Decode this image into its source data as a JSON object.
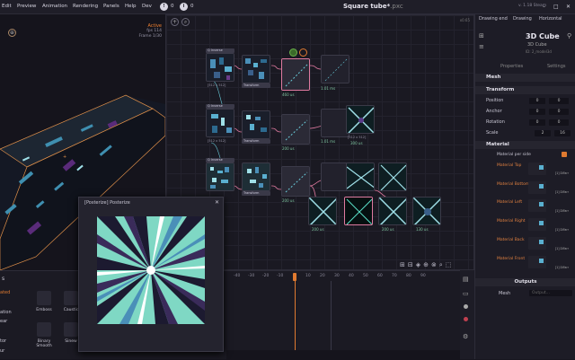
{
  "menubar": {
    "items": [
      "Edit",
      "Preview",
      "Animation",
      "Rendering",
      "Panels",
      "Help",
      "Dev"
    ],
    "counter1": "0",
    "counter2": "0",
    "title": "Square tube*",
    "title_ext": ".pxc",
    "version": "v. 1.18 Steam",
    "win_min": "–",
    "win_max": "□",
    "win_close": "✕"
  },
  "viewport": {
    "status": "Active",
    "fps": "fps 114",
    "frame": "Frame 1/30"
  },
  "graph": {
    "zoom": "x0.65",
    "nodes_top_label": "Q Inverse",
    "sizes": [
      "[512 x 512]",
      "[512 x 512]",
      "[512 x 512]"
    ],
    "times": [
      "460 us",
      "1.01 ms",
      "1.01 ms",
      "200 us",
      "200 us",
      "300 us",
      "200 us",
      "200 us",
      "130 us",
      "200 us"
    ],
    "transform": "Transform",
    "tile": "Tile",
    "blend": "Blend",
    "ftype": "32bit"
  },
  "inspector": {
    "tabs": [
      "Drawing end",
      "Drawing",
      "Horizontal"
    ],
    "node_title": "3D Cube",
    "node_sub": "3D Cube",
    "node_id": "ID: 2_model3d",
    "sub_tabs": [
      "Properties",
      "Settings"
    ],
    "sections": {
      "mesh": "Mesh",
      "transform": "Transform",
      "material": "Material",
      "outputs": "Outputs"
    },
    "rows": [
      {
        "label": "Position",
        "v1": "0",
        "v2": "0"
      },
      {
        "label": "Anchor",
        "v1": "0",
        "v2": "0"
      },
      {
        "label": "Rotation",
        "v1": "0",
        "v2": "0"
      },
      {
        "label": "Scale",
        "v1": "2",
        "v2": "16"
      }
    ],
    "material_per_side": "Material per side",
    "materials": [
      "Material Top",
      "Material Bottom",
      "Material Left",
      "Material Right",
      "Material Back",
      "Material Front"
    ],
    "mat_tag": "[1] DiFarr",
    "mesh_output": "Mesh",
    "mesh_placeholder": "Output..."
  },
  "timeline": {
    "ticks": [
      "-40",
      "-30",
      "-20",
      "-10",
      "0",
      "10",
      "20",
      "30",
      "40",
      "50",
      "60",
      "70",
      "80",
      "90"
    ]
  },
  "collection": {
    "header": "s",
    "filter": "...ion",
    "side_items": [
      "ated",
      "ation",
      "ear",
      "tor",
      "ur"
    ],
    "items": [
      "Emboss",
      "Caustic",
      "Binary Smooth",
      "Sinew",
      "Ripple",
      "Depth Display"
    ]
  },
  "preview": {
    "title": "[Posterize] Posterize",
    "close": "✕"
  },
  "colors": {
    "accent": "#e07a30",
    "bg": "#17161f",
    "panel": "#1d1c26",
    "wire": "#e07aa0",
    "teal": "#5ce0c8"
  }
}
